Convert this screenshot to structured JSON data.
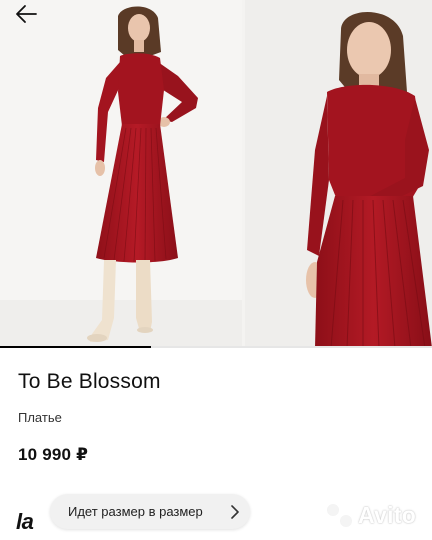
{
  "product": {
    "title": "To Be Blossom",
    "category": "Платье",
    "price": "10 990 ₽"
  },
  "gallery": {
    "photo_count": 2,
    "progress_fraction": 0.35,
    "photos": [
      {
        "subject": "woman-in-red-pleated-knit-dress-full-length"
      },
      {
        "subject": "woman-in-red-pleated-knit-dress-closeup"
      }
    ]
  },
  "badges": {
    "size_fit": "Идет размер в размер"
  },
  "brand_logo": "la",
  "watermark": "Avito",
  "icons": {
    "back": "arrow-left-icon",
    "chip": "chevron-right-icon"
  },
  "colors": {
    "dress": "#a3141f",
    "dress_dark": "#7c0e17",
    "background": "#ffffff",
    "text": "#111111",
    "chip_background": "#f1f1f1",
    "progress": "#000000"
  }
}
